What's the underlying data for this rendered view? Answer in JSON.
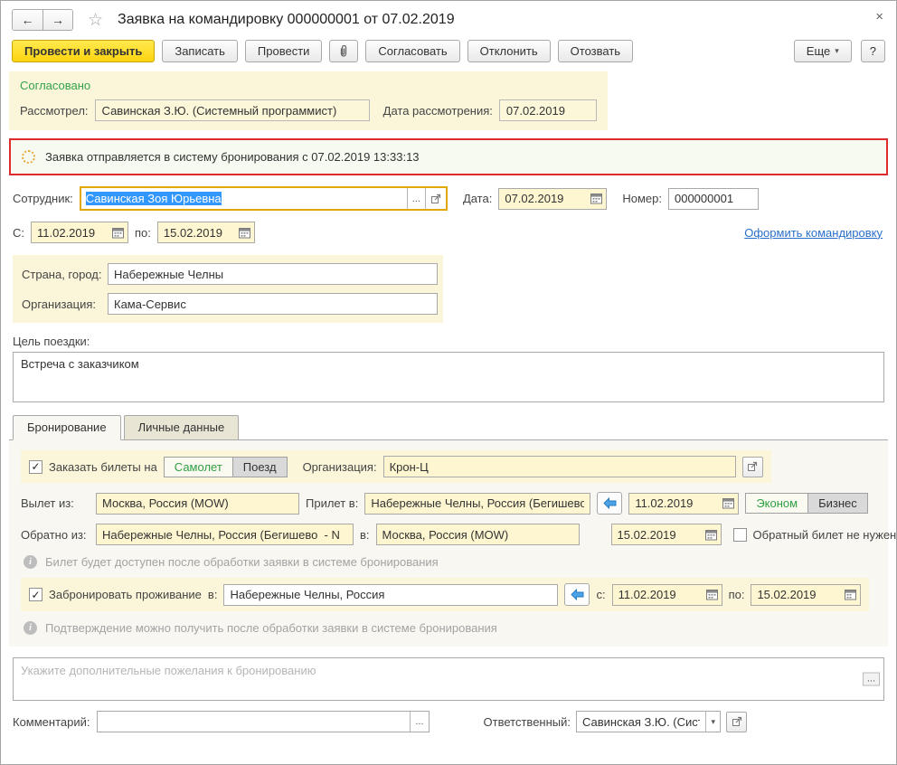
{
  "icons": {
    "back": "←",
    "forward": "→",
    "star": "☆",
    "close": "×",
    "dropdown": "▾",
    "ellipsis": "...",
    "check": "✓",
    "info": "i"
  },
  "window": {
    "title": "Заявка на командировку 000000001 от 07.02.2019"
  },
  "toolbar": {
    "post_and_close": "Провести и закрыть",
    "write": "Записать",
    "post": "Провести",
    "approve": "Согласовать",
    "reject": "Отклонить",
    "recall": "Отозвать",
    "more": "Еще",
    "help": "?"
  },
  "approval": {
    "status": "Согласовано",
    "reviewer_label": "Рассмотрел:",
    "reviewer": "Савинская З.Ю. (Системный программист)",
    "date_label": "Дата рассмотрения:",
    "date": "07.02.2019"
  },
  "notification": {
    "message": "Заявка отправляется в систему бронирования с 07.02.2019 13:33:13"
  },
  "form": {
    "employee_label": "Сотрудник:",
    "employee": "Савинская Зоя Юрьевна",
    "date_label": "Дата:",
    "date": "07.02.2019",
    "number_label": "Номер:",
    "number": "000000001",
    "from_label": "С:",
    "from_date": "11.02.2019",
    "to_label": "по:",
    "to_date": "15.02.2019",
    "make_trip_link": "Оформить командировку",
    "city_label": "Страна, город:",
    "city": "Набережные Челны",
    "organization_label": "Организация:",
    "organization": "Кама-Сервис",
    "purpose_label": "Цель поездки:",
    "purpose": "Встреча с заказчиком"
  },
  "tabs": {
    "booking": "Бронирование",
    "personal": "Личные данные"
  },
  "booking": {
    "order_tickets_label": "Заказать билеты на",
    "plane": "Самолет",
    "train": "Поезд",
    "organization_label": "Организация:",
    "organization": "Крон-Ц",
    "depart_from_label": "Вылет из:",
    "depart_from": "Москва, Россия (MOW)",
    "arrive_to_label": "Прилет в:",
    "arrive_to": "Набережные Челны, Россия (Бегишево",
    "depart_date": "11.02.2019",
    "econom": "Эконом",
    "business": "Бизнес",
    "return_from_label": "Обратно из:",
    "return_from": "Набережные Челны, Россия (Бегишево  - N",
    "return_to_label": "в:",
    "return_to": "Москва, Россия (MOW)",
    "return_date": "15.02.2019",
    "no_return_ticket": "Обратный билет не нужен",
    "ticket_note": "Билет будет доступен после обработки заявки в системе бронирования",
    "hotel_label": "Забронировать проживание",
    "hotel_in_label": "в:",
    "hotel_city": "Набережные Челны, Россия",
    "hotel_from_label": "с:",
    "hotel_from": "11.02.2019",
    "hotel_to_label": "по:",
    "hotel_to": "15.02.2019",
    "hotel_note": "Подтверждение можно получить после обработки заявки в системе бронирования",
    "wishes_placeholder": "Укажите дополнительные пожелания к бронированию"
  },
  "footer": {
    "comment_label": "Комментарий:",
    "comment": "",
    "responsible_label": "Ответственный:",
    "responsible": "Савинская З.Ю. (Системн"
  }
}
